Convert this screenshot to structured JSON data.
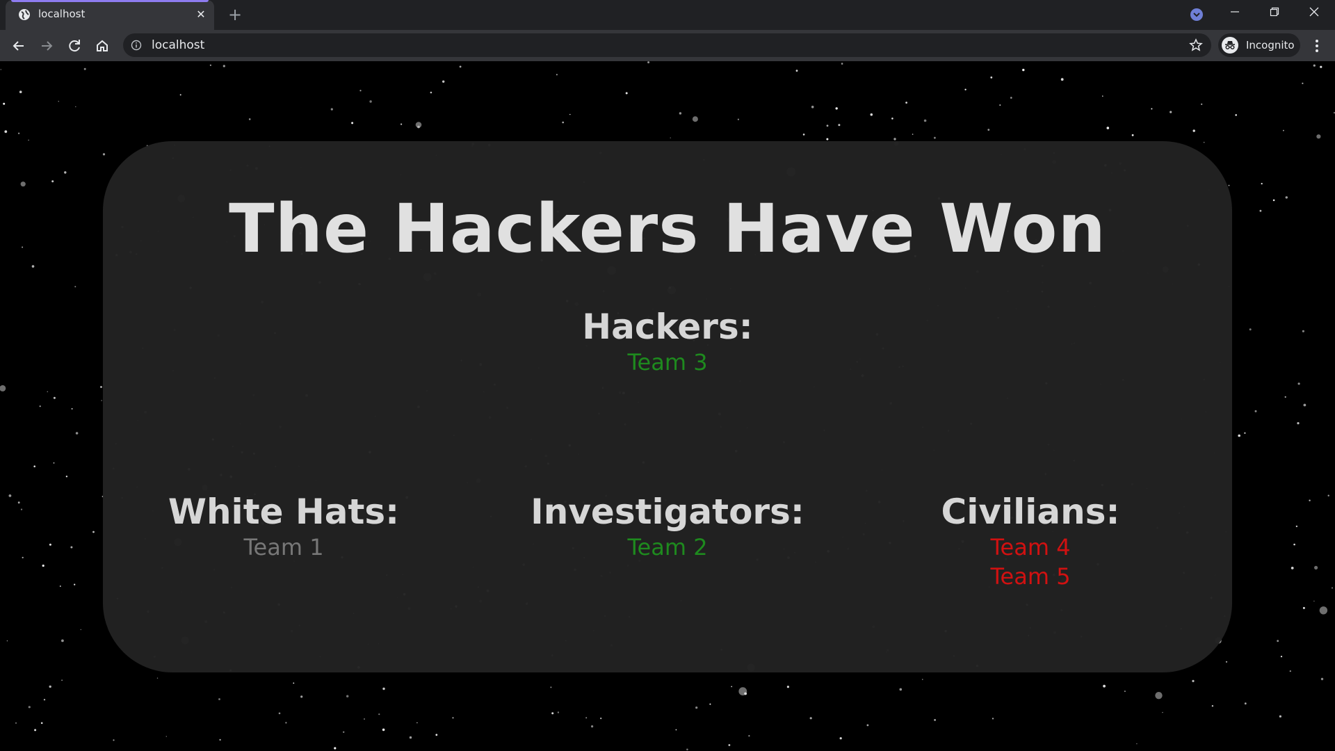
{
  "browser": {
    "tab_title": "localhost",
    "url": "localhost",
    "profile_label": "Incognito",
    "accent_color": "#8e7cf0"
  },
  "page": {
    "headline": "The Hackers Have Won",
    "groups": {
      "hackers": {
        "title": "Hackers:",
        "teams": [
          {
            "name": "Team 3",
            "color": "#1e8a1e"
          }
        ]
      },
      "white_hats": {
        "title": "White Hats:",
        "teams": [
          {
            "name": "Team 1",
            "color": "#777777"
          }
        ]
      },
      "investigators": {
        "title": "Investigators:",
        "teams": [
          {
            "name": "Team 2",
            "color": "#1e8a1e"
          }
        ]
      },
      "civilians": {
        "title": "Civilians:",
        "teams": [
          {
            "name": "Team 4",
            "color": "#d11111"
          },
          {
            "name": "Team 5",
            "color": "#d11111"
          }
        ]
      }
    }
  },
  "icons": {
    "back": "arrow-left-icon",
    "forward": "arrow-right-icon",
    "reload": "reload-icon",
    "home": "home-icon",
    "info": "info-icon",
    "bookmark": "star-icon",
    "menu": "kebab-menu-icon",
    "incognito": "incognito-icon"
  }
}
